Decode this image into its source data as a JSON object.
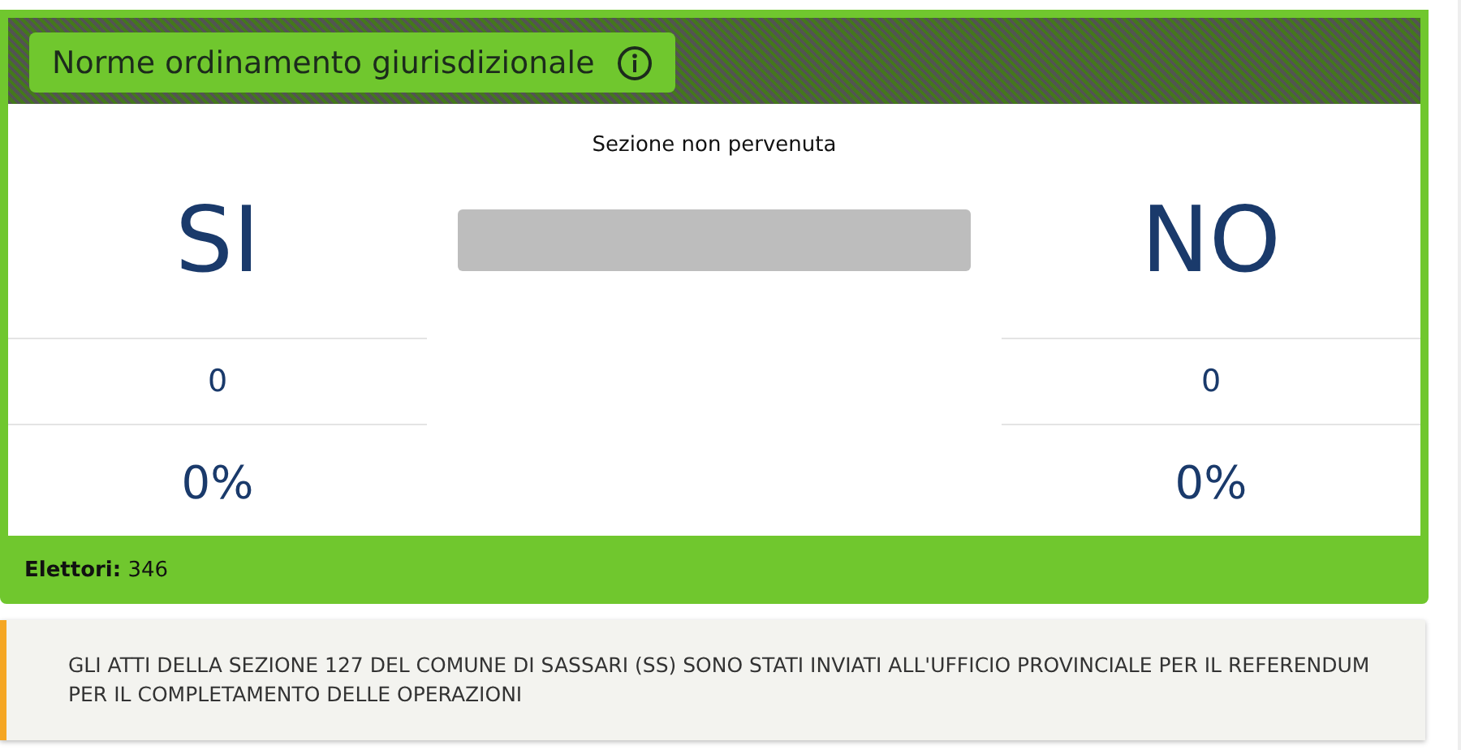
{
  "card": {
    "title": "Norme ordinamento giurisdizionale",
    "status": "Sezione non pervenuta",
    "options": [
      {
        "label": "SI",
        "votes": "0",
        "percent": "0%"
      },
      {
        "label": "NO",
        "votes": "0",
        "percent": "0%"
      }
    ],
    "footer": "**Elettori:** 346"
  },
  "notice": {
    "lines": [
      "GLI ATTI DELLA SEZIONE 127 DEL COMUNE DI SASSARI (SS) SONO STATI INVIATI ALL'UFFICIO PROVINCIALE PER IL REFERENDUM",
      "PER IL COMPLETAMENTO DELLE OPERAZIONI"
    ]
  }
}
